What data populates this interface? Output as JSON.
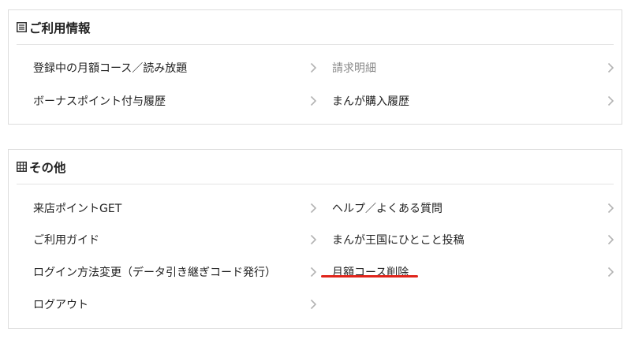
{
  "usage_section": {
    "title": "ご利用情報",
    "icon": "list-icon",
    "items_left": [
      {
        "label": "登録中の月額コース／読み放題"
      },
      {
        "label": "ボーナスポイント付与履歴"
      }
    ],
    "items_right": [
      {
        "label": "請求明細"
      },
      {
        "label": "まんが購入履歴"
      }
    ]
  },
  "other_section": {
    "title": "その他",
    "icon": "grid-icon",
    "items_left": [
      {
        "label": "来店ポイントGET"
      },
      {
        "label": "ご利用ガイド"
      },
      {
        "label": "ログイン方法変更（データ引き継ぎコード発行）"
      },
      {
        "label": "ログアウト"
      }
    ],
    "items_right": [
      {
        "label": "ヘルプ／よくある質問"
      },
      {
        "label": "まんが王国にひとこと投稿"
      },
      {
        "label": "月額コース削除"
      }
    ]
  },
  "colors": {
    "annotation": "#e0241b",
    "border": "#dcdcdc",
    "chevron": "#b3b3b3"
  }
}
